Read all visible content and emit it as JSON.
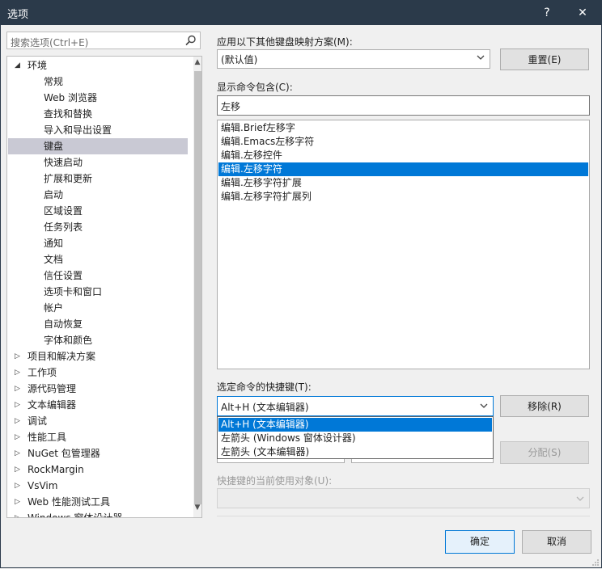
{
  "window": {
    "title": "选项",
    "help": "?",
    "close": "✕"
  },
  "search": {
    "placeholder": "搜索选项(Ctrl+E)"
  },
  "tree": {
    "items": [
      {
        "label": "环境",
        "level": 0,
        "expander": "expanded"
      },
      {
        "label": "常规",
        "level": 1
      },
      {
        "label": "Web 浏览器",
        "level": 1
      },
      {
        "label": "查找和替换",
        "level": 1
      },
      {
        "label": "导入和导出设置",
        "level": 1
      },
      {
        "label": "键盘",
        "level": 1,
        "selected": true
      },
      {
        "label": "快速启动",
        "level": 1
      },
      {
        "label": "扩展和更新",
        "level": 1
      },
      {
        "label": "启动",
        "level": 1
      },
      {
        "label": "区域设置",
        "level": 1
      },
      {
        "label": "任务列表",
        "level": 1
      },
      {
        "label": "通知",
        "level": 1
      },
      {
        "label": "文档",
        "level": 1
      },
      {
        "label": "信任设置",
        "level": 1
      },
      {
        "label": "选项卡和窗口",
        "level": 1
      },
      {
        "label": "帐户",
        "level": 1
      },
      {
        "label": "自动恢复",
        "level": 1
      },
      {
        "label": "字体和颜色",
        "level": 1
      },
      {
        "label": "项目和解决方案",
        "level": 0,
        "expander": "collapsed"
      },
      {
        "label": "工作项",
        "level": 0,
        "expander": "collapsed"
      },
      {
        "label": "源代码管理",
        "level": 0,
        "expander": "collapsed"
      },
      {
        "label": "文本编辑器",
        "level": 0,
        "expander": "collapsed"
      },
      {
        "label": "调试",
        "level": 0,
        "expander": "collapsed"
      },
      {
        "label": "性能工具",
        "level": 0,
        "expander": "collapsed"
      },
      {
        "label": "NuGet 包管理器",
        "level": 0,
        "expander": "collapsed"
      },
      {
        "label": "RockMargin",
        "level": 0,
        "expander": "collapsed"
      },
      {
        "label": "VsVim",
        "level": 0,
        "expander": "collapsed"
      },
      {
        "label": "Web 性能测试工具",
        "level": 0,
        "expander": "collapsed"
      },
      {
        "label": "Windows 窗体设计器",
        "level": 0,
        "expander": "collapsed"
      }
    ]
  },
  "mapping": {
    "label": "应用以下其他键盘映射方案(M):",
    "value": "(默认值)",
    "reset_button": "重置(E)"
  },
  "commands": {
    "label": "显示命令包含(C):",
    "filter_value": "左移",
    "items": [
      {
        "label": "编辑.Brief左移字"
      },
      {
        "label": "编辑.Emacs左移字符"
      },
      {
        "label": "编辑.左移控件"
      },
      {
        "label": "编辑.左移字符",
        "selected": true
      },
      {
        "label": "编辑.左移字符扩展"
      },
      {
        "label": "编辑.左移字符扩展列"
      }
    ]
  },
  "shortcuts": {
    "label": "选定命令的快捷键(T):",
    "value": "Alt+H (文本编辑器)",
    "remove_button": "移除(R)",
    "options": [
      {
        "label": "Alt+H (文本编辑器)",
        "selected": true
      },
      {
        "label": "左箭头 (Windows 窗体设计器)"
      },
      {
        "label": "左箭头 (文本编辑器)"
      }
    ],
    "assign_button": "分配(S)"
  },
  "used_by": {
    "label": "快捷键的当前使用对象(U):",
    "value": ""
  },
  "footer": {
    "ok_button": "确定",
    "cancel_button": "取消"
  }
}
